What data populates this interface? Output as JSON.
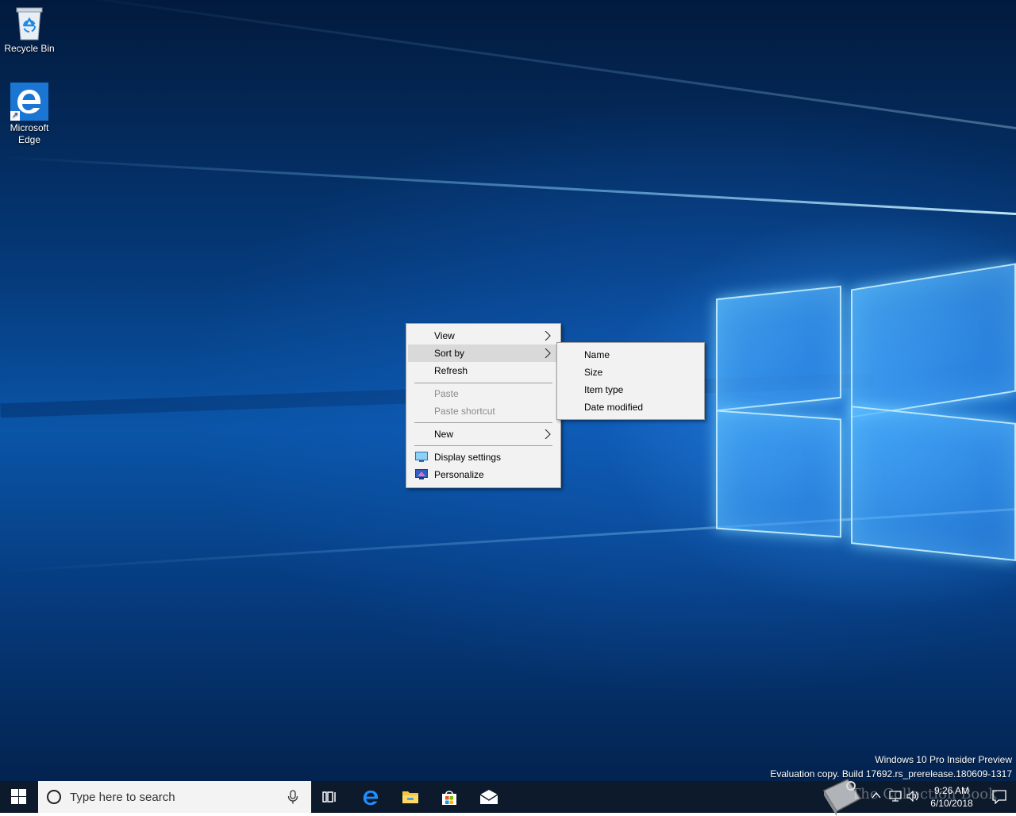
{
  "desktop": {
    "icons": [
      {
        "label": "Recycle Bin",
        "icon": "recycle-bin-icon"
      },
      {
        "label": "Microsoft Edge",
        "icon": "edge-icon"
      }
    ],
    "watermark": {
      "line1": "Windows 10 Pro Insider Preview",
      "line2": "Evaluation copy. Build 17692.rs_prerelease.180609-1317"
    }
  },
  "context_menu": {
    "items": [
      {
        "label": "View",
        "submenu": true,
        "enabled": true
      },
      {
        "label": "Sort by",
        "submenu": true,
        "enabled": true,
        "highlighted": true
      },
      {
        "label": "Refresh",
        "submenu": false,
        "enabled": true
      },
      {
        "label": "Paste",
        "submenu": false,
        "enabled": false
      },
      {
        "label": "Paste shortcut",
        "submenu": false,
        "enabled": false
      },
      {
        "label": "New",
        "submenu": true,
        "enabled": true
      },
      {
        "label": "Display settings",
        "icon": "display-settings-icon",
        "enabled": true
      },
      {
        "label": "Personalize",
        "icon": "personalize-icon",
        "enabled": true
      }
    ]
  },
  "sort_submenu": {
    "items": [
      {
        "label": "Name"
      },
      {
        "label": "Size"
      },
      {
        "label": "Item type"
      },
      {
        "label": "Date modified"
      }
    ]
  },
  "taskbar": {
    "search_placeholder": "Type here to search",
    "pinned": [
      "task-view-icon",
      "edge-icon",
      "file-explorer-icon",
      "store-icon",
      "mail-icon"
    ],
    "clock": {
      "time": "9:26 AM",
      "date": "6/10/2018"
    },
    "overlay_text": "The Collection Book"
  },
  "colors": {
    "taskbar": "#0d1a2c",
    "menu_bg": "#f2f2f2",
    "menu_highlight": "#d9d9d9",
    "accent": "#1a76d2"
  }
}
